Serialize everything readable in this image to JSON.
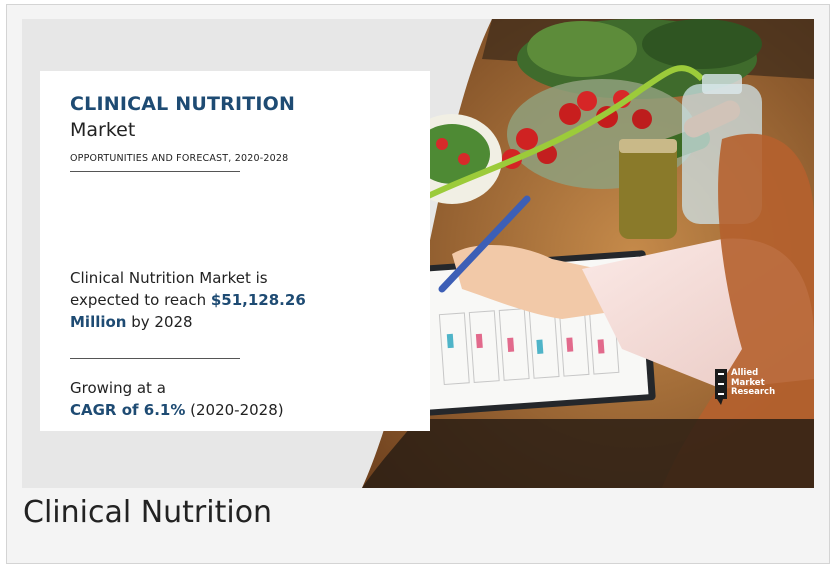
{
  "banner": {
    "title": "CLINICAL NUTRITION",
    "subtitle": "Market",
    "tagline": "OPPORTUNITIES AND FORECAST, 2020-2028",
    "stat": {
      "line1": "Clinical Nutrition Market is",
      "line2_pre": "expected to reach ",
      "value": "$51,128.26",
      "unit": "Million",
      "line3_post": " by 2028"
    },
    "growth": {
      "line1": "Growing at a",
      "cagr": "CAGR of 6.1%",
      "period": " (2020-2028)"
    },
    "logo": {
      "lines": [
        "Allied",
        "Market",
        "Research"
      ]
    }
  },
  "caption": "Clinical Nutrition",
  "colors": {
    "accent": "#1e4b73",
    "text": "#222222",
    "card_bg": "#f4f4f4"
  }
}
